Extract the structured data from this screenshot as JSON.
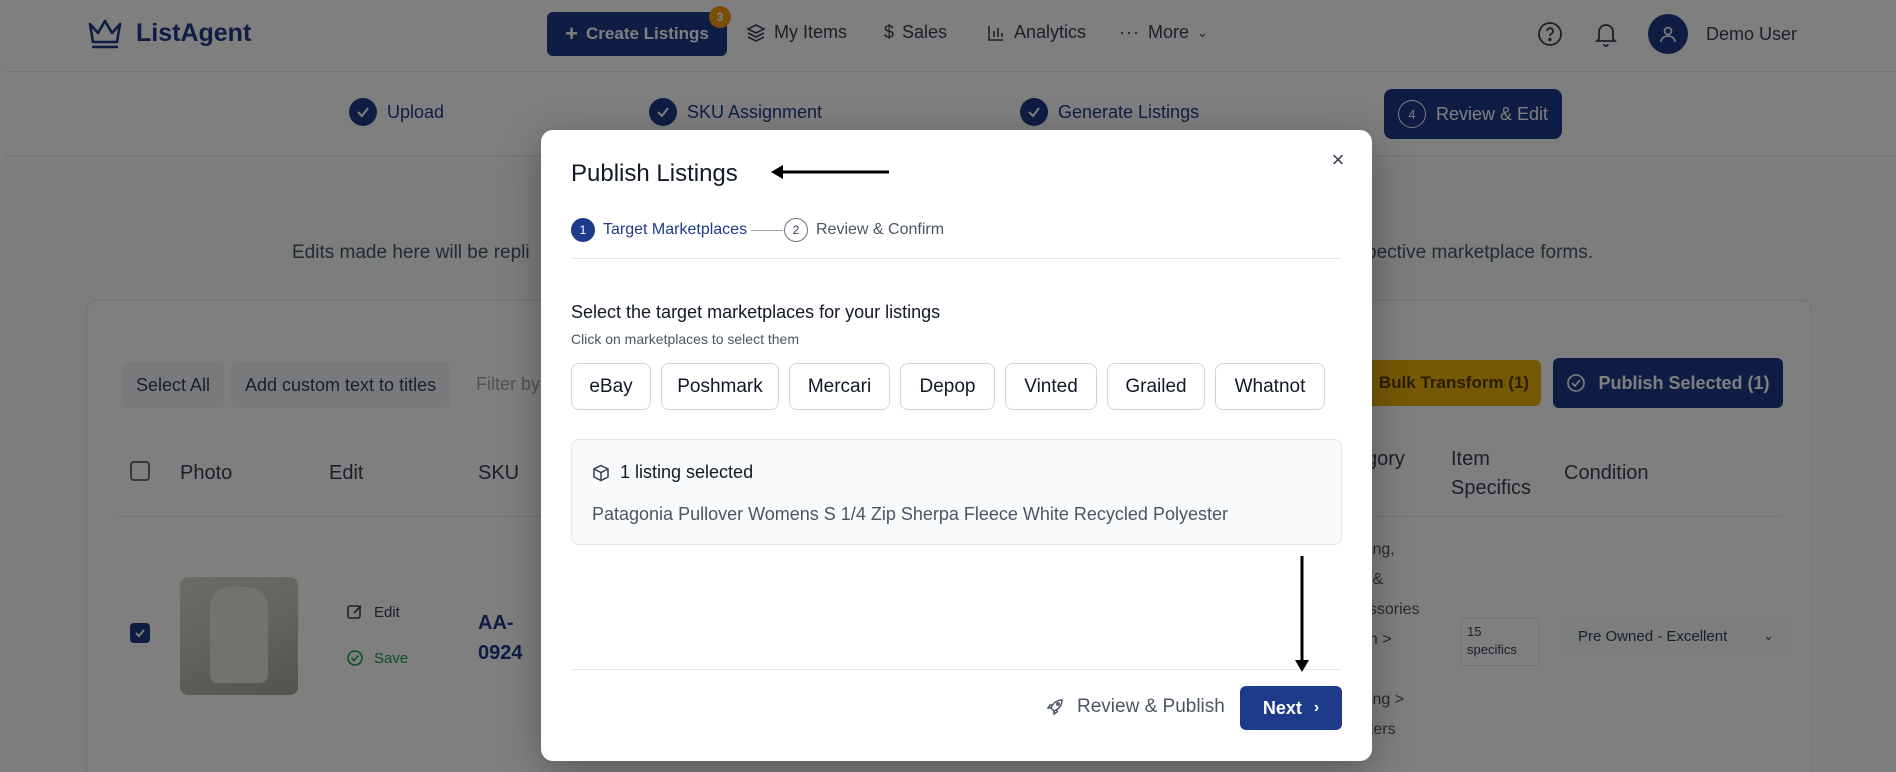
{
  "app": {
    "name": "ListAgent"
  },
  "nav": {
    "create_label": "Create Listings",
    "create_badge": "3",
    "items": [
      {
        "label": "My Items",
        "icon": "layers-icon"
      },
      {
        "label": "Sales",
        "icon": "dollar-icon"
      },
      {
        "label": "Analytics",
        "icon": "bar-chart-icon"
      },
      {
        "label": "More",
        "icon": "more-icon"
      }
    ],
    "user": "Demo User"
  },
  "stepper": {
    "steps": [
      {
        "label": "Upload",
        "status": "done"
      },
      {
        "label": "SKU Assignment",
        "status": "done"
      },
      {
        "label": "Generate Listings",
        "status": "done"
      },
      {
        "label": "Review & Edit",
        "status": "active",
        "number": "4"
      }
    ]
  },
  "info": {
    "left": "Edits made here will be repli",
    "right": "pective marketplace forms."
  },
  "toolbar": {
    "select_all": "Select All",
    "add_custom": "Add custom text to titles",
    "filter_placeholder": "Filter by",
    "bulk_transform": "Bulk Transform (1)",
    "publish_selected": "Publish Selected (1)"
  },
  "table": {
    "headers": {
      "photo": "Photo",
      "edit": "Edit",
      "sku": "SKU",
      "category": "gory",
      "item_specifics_1": "Item",
      "item_specifics_2": "Specifics",
      "condition": "Condition"
    },
    "row": {
      "edit": "Edit",
      "save": "Save",
      "sku_1": "AA-",
      "sku_2": "0924",
      "category_lines": [
        "hing,",
        "s &",
        "essories",
        "en >",
        "s",
        "ning >",
        "aters"
      ],
      "specifics_1": "15",
      "specifics_2": "specifics",
      "condition": "Pre Owned - Excellent"
    }
  },
  "modal": {
    "title": "Publish Listings",
    "steps": [
      {
        "number": "1",
        "label": "Target Marketplaces"
      },
      {
        "number": "2",
        "label": "Review & Confirm"
      }
    ],
    "section_title": "Select the target marketplaces for your listings",
    "section_subtitle": "Click on marketplaces to select them",
    "marketplaces": [
      "eBay",
      "Poshmark",
      "Mercari",
      "Depop",
      "Vinted",
      "Grailed",
      "Whatnot"
    ],
    "selection_header": "1 listing selected",
    "selection_item": "Patagonia Pullover Womens S 1/4 Zip Sherpa Fleece White Recycled Polyester",
    "review_publish": "Review & Publish",
    "next": "Next"
  },
  "colors": {
    "brand": "#1e3a8a",
    "accent_yellow": "#eab308",
    "badge": "#f59e0b"
  }
}
